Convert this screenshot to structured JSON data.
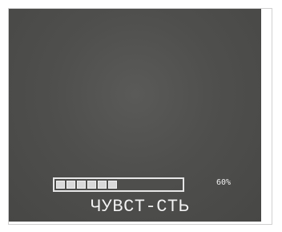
{
  "osd": {
    "setting_label": "ЧУВСТ-СТЬ",
    "percent_text": "60%",
    "progress": {
      "value_percent": 60,
      "segments_filled": 6
    }
  }
}
